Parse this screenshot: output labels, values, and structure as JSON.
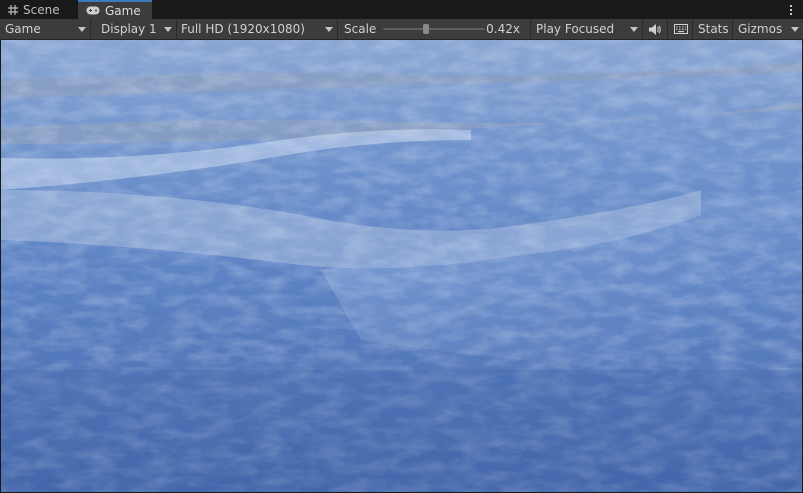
{
  "tabs": [
    {
      "label": "Scene",
      "icon": "grid-icon"
    },
    {
      "label": "Game",
      "icon": "gamepad-icon"
    }
  ],
  "toolbar": {
    "mode": "Game",
    "display": "Display 1",
    "resolution": "Full HD (1920x1080)",
    "scale_label": "Scale",
    "scale_value": "0.42x",
    "scale_fraction": 0.42,
    "play_mode": "Play Focused",
    "audio_icon": "speaker-icon",
    "keyboard_icon": "keyboard-icon",
    "stats": "Stats",
    "gizmos": "Gizmos"
  },
  "colors": {
    "accent": "#3a79bb",
    "toolbar_bg": "#3c3c3c",
    "tab_bg": "#191919",
    "water_light": "#b5c9ec",
    "water_mid": "#5c83c2",
    "water_dark": "#3e62a6"
  }
}
